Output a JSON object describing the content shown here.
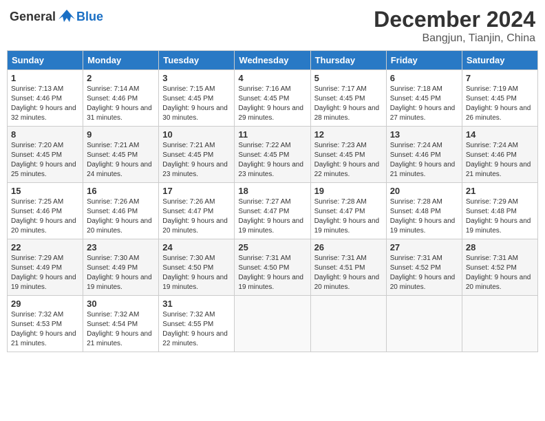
{
  "header": {
    "logo_general": "General",
    "logo_blue": "Blue",
    "month": "December 2024",
    "location": "Bangjun, Tianjin, China"
  },
  "days_of_week": [
    "Sunday",
    "Monday",
    "Tuesday",
    "Wednesday",
    "Thursday",
    "Friday",
    "Saturday"
  ],
  "weeks": [
    [
      {
        "num": "1",
        "sunrise": "7:13 AM",
        "sunset": "4:46 PM",
        "daylight": "9 hours and 32 minutes."
      },
      {
        "num": "2",
        "sunrise": "7:14 AM",
        "sunset": "4:46 PM",
        "daylight": "9 hours and 31 minutes."
      },
      {
        "num": "3",
        "sunrise": "7:15 AM",
        "sunset": "4:45 PM",
        "daylight": "9 hours and 30 minutes."
      },
      {
        "num": "4",
        "sunrise": "7:16 AM",
        "sunset": "4:45 PM",
        "daylight": "9 hours and 29 minutes."
      },
      {
        "num": "5",
        "sunrise": "7:17 AM",
        "sunset": "4:45 PM",
        "daylight": "9 hours and 28 minutes."
      },
      {
        "num": "6",
        "sunrise": "7:18 AM",
        "sunset": "4:45 PM",
        "daylight": "9 hours and 27 minutes."
      },
      {
        "num": "7",
        "sunrise": "7:19 AM",
        "sunset": "4:45 PM",
        "daylight": "9 hours and 26 minutes."
      }
    ],
    [
      {
        "num": "8",
        "sunrise": "7:20 AM",
        "sunset": "4:45 PM",
        "daylight": "9 hours and 25 minutes."
      },
      {
        "num": "9",
        "sunrise": "7:21 AM",
        "sunset": "4:45 PM",
        "daylight": "9 hours and 24 minutes."
      },
      {
        "num": "10",
        "sunrise": "7:21 AM",
        "sunset": "4:45 PM",
        "daylight": "9 hours and 23 minutes."
      },
      {
        "num": "11",
        "sunrise": "7:22 AM",
        "sunset": "4:45 PM",
        "daylight": "9 hours and 23 minutes."
      },
      {
        "num": "12",
        "sunrise": "7:23 AM",
        "sunset": "4:45 PM",
        "daylight": "9 hours and 22 minutes."
      },
      {
        "num": "13",
        "sunrise": "7:24 AM",
        "sunset": "4:46 PM",
        "daylight": "9 hours and 21 minutes."
      },
      {
        "num": "14",
        "sunrise": "7:24 AM",
        "sunset": "4:46 PM",
        "daylight": "9 hours and 21 minutes."
      }
    ],
    [
      {
        "num": "15",
        "sunrise": "7:25 AM",
        "sunset": "4:46 PM",
        "daylight": "9 hours and 20 minutes."
      },
      {
        "num": "16",
        "sunrise": "7:26 AM",
        "sunset": "4:46 PM",
        "daylight": "9 hours and 20 minutes."
      },
      {
        "num": "17",
        "sunrise": "7:26 AM",
        "sunset": "4:47 PM",
        "daylight": "9 hours and 20 minutes."
      },
      {
        "num": "18",
        "sunrise": "7:27 AM",
        "sunset": "4:47 PM",
        "daylight": "9 hours and 19 minutes."
      },
      {
        "num": "19",
        "sunrise": "7:28 AM",
        "sunset": "4:47 PM",
        "daylight": "9 hours and 19 minutes."
      },
      {
        "num": "20",
        "sunrise": "7:28 AM",
        "sunset": "4:48 PM",
        "daylight": "9 hours and 19 minutes."
      },
      {
        "num": "21",
        "sunrise": "7:29 AM",
        "sunset": "4:48 PM",
        "daylight": "9 hours and 19 minutes."
      }
    ],
    [
      {
        "num": "22",
        "sunrise": "7:29 AM",
        "sunset": "4:49 PM",
        "daylight": "9 hours and 19 minutes."
      },
      {
        "num": "23",
        "sunrise": "7:30 AM",
        "sunset": "4:49 PM",
        "daylight": "9 hours and 19 minutes."
      },
      {
        "num": "24",
        "sunrise": "7:30 AM",
        "sunset": "4:50 PM",
        "daylight": "9 hours and 19 minutes."
      },
      {
        "num": "25",
        "sunrise": "7:31 AM",
        "sunset": "4:50 PM",
        "daylight": "9 hours and 19 minutes."
      },
      {
        "num": "26",
        "sunrise": "7:31 AM",
        "sunset": "4:51 PM",
        "daylight": "9 hours and 20 minutes."
      },
      {
        "num": "27",
        "sunrise": "7:31 AM",
        "sunset": "4:52 PM",
        "daylight": "9 hours and 20 minutes."
      },
      {
        "num": "28",
        "sunrise": "7:31 AM",
        "sunset": "4:52 PM",
        "daylight": "9 hours and 20 minutes."
      }
    ],
    [
      {
        "num": "29",
        "sunrise": "7:32 AM",
        "sunset": "4:53 PM",
        "daylight": "9 hours and 21 minutes."
      },
      {
        "num": "30",
        "sunrise": "7:32 AM",
        "sunset": "4:54 PM",
        "daylight": "9 hours and 21 minutes."
      },
      {
        "num": "31",
        "sunrise": "7:32 AM",
        "sunset": "4:55 PM",
        "daylight": "9 hours and 22 minutes."
      },
      null,
      null,
      null,
      null
    ]
  ]
}
